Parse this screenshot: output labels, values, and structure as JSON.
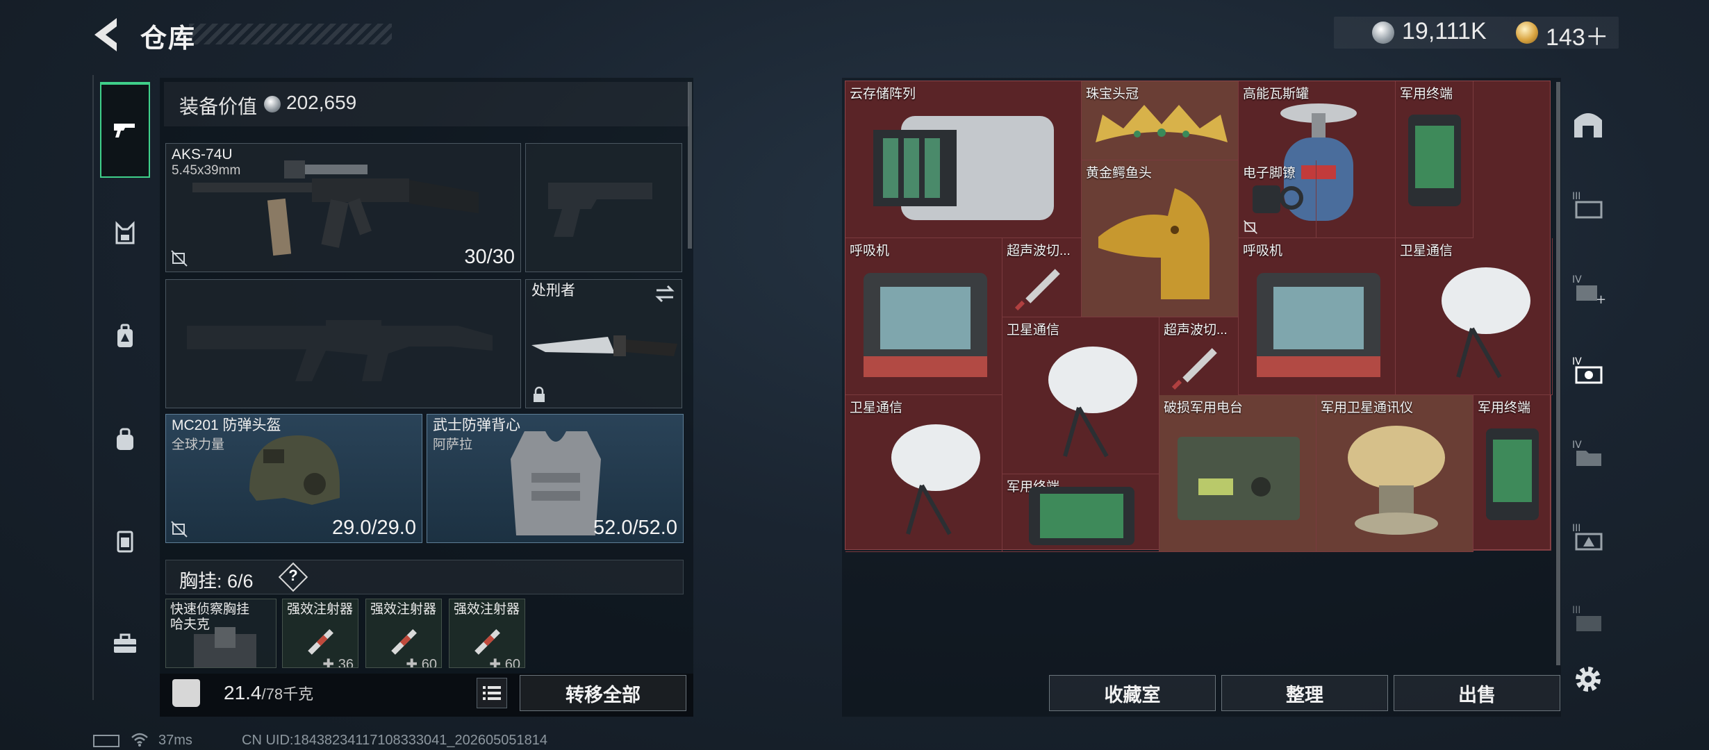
{
  "header": {
    "title": "仓库",
    "currency": {
      "silver": "19,111K",
      "gold": "143＋"
    }
  },
  "equipment": {
    "value_label": "装备价值",
    "value": "202,659",
    "primary_weapon": {
      "name": "AKS-74U",
      "ammo": "5.45x39mm",
      "count": "30/30"
    },
    "melee": {
      "name": "处刑者"
    },
    "helmet": {
      "name": "MC201 防弹头盔",
      "sub": "全球力量",
      "durability": "29.0/29.0"
    },
    "armor": {
      "name": "武士防弹背心",
      "sub": "阿萨拉",
      "durability": "52.0/52.0"
    },
    "rig": {
      "label": "胸挂:",
      "capacity": "6/6",
      "help": "?",
      "main": {
        "name": "快速侦察胸挂",
        "sub": "哈夫克"
      },
      "items": [
        {
          "name": "强效注射器",
          "qty": "36"
        },
        {
          "name": "强效注射器",
          "qty": "60"
        },
        {
          "name": "强效注射器",
          "qty": "60"
        }
      ]
    },
    "weight": {
      "current": "21.4",
      "max": "/78千克"
    },
    "transfer_all": "转移全部"
  },
  "storage": {
    "items": [
      {
        "label": "云存储阵列"
      },
      {
        "label": "珠宝头冠"
      },
      {
        "label": "高能瓦斯罐"
      },
      {
        "label": "军用终端"
      },
      {
        "label": "黄金鳄鱼头"
      },
      {
        "label": "电子脚镣"
      },
      {
        "label": "呼吸机"
      },
      {
        "label": "超声波切..."
      },
      {
        "label": "呼吸机"
      },
      {
        "label": "卫星通信"
      },
      {
        "label": "卫星通信"
      },
      {
        "label": "超声波切..."
      },
      {
        "label": "卫星通信"
      },
      {
        "label": "破损军用电台"
      },
      {
        "label": "军用卫星通讯仪"
      },
      {
        "label": "军用终端"
      },
      {
        "label": "军用终端"
      }
    ],
    "buttons": {
      "collection": "收藏室",
      "sort": "整理",
      "sell": "出售"
    }
  },
  "right_tabs": [
    "home-tab",
    "storage-III-tab",
    "storage-IV-plus-tab",
    "storage-IV-active-tab",
    "storage-IV-folder-tab",
    "storage-III-a-tab",
    "storage-III-b-tab"
  ],
  "status": {
    "ping": "37ms",
    "uid": "CN UID:18438234117108333041_202605051814"
  },
  "colors": {
    "accent_green": "#3fd08a",
    "storage_bg": "#5a2427",
    "helmet_slot": "#2a4358"
  }
}
